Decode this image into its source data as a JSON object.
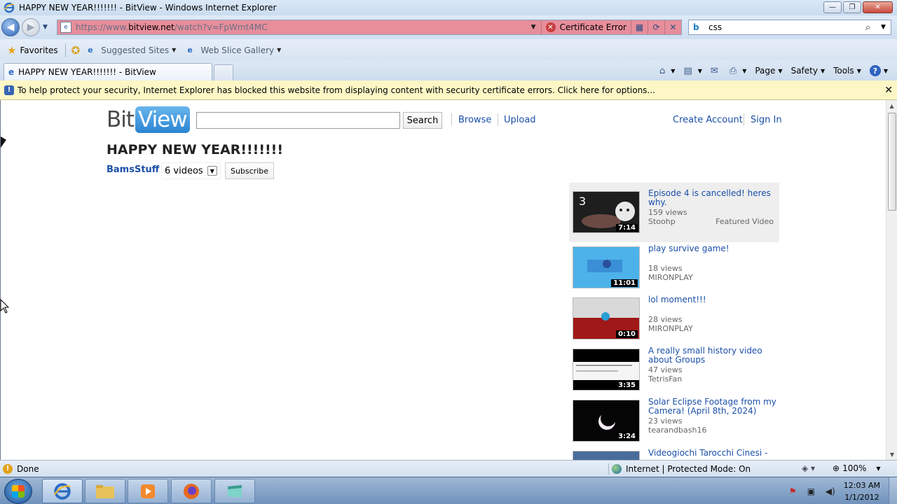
{
  "window": {
    "title": "HAPPY NEW YEAR!!!!!!! - BitView - Windows Internet Explorer",
    "controls": {
      "minimize": "—",
      "maximize": "❐",
      "close": "✕"
    }
  },
  "address_bar": {
    "url_prefix": "https://www.",
    "url_domain": "bitview.net",
    "url_path": "/watch?v=FpWmt4MC",
    "certificate_error": "Certificate Error"
  },
  "search_bar": {
    "provider_icon": "b",
    "value": "css"
  },
  "favorites_bar": {
    "favorites_label": "Favorites",
    "links": [
      {
        "label": "Suggested Sites"
      },
      {
        "label": "Web Slice Gallery"
      }
    ]
  },
  "tabs": [
    {
      "label": "HAPPY NEW YEAR!!!!!!! - BitView"
    }
  ],
  "command_bar": {
    "page": "Page",
    "safety": "Safety",
    "tools": "Tools"
  },
  "security_bar": {
    "message": "To help protect your security, Internet Explorer has blocked this website from displaying content with security certificate errors. Click here for options..."
  },
  "site": {
    "logo_bit": "Bit",
    "logo_view": "View",
    "search_button": "Search",
    "nav": {
      "browse": "Browse",
      "upload": "Upload",
      "create_account": "Create Account",
      "sign_in": "Sign In"
    },
    "video_title": "HAPPY NEW YEAR!!!!!!!",
    "channel": "BamsStuff",
    "video_count": "6 videos",
    "subscribe": "Subscribe"
  },
  "related_videos": [
    {
      "title": "Episode 4 is cancelled! heres why.",
      "views": "159 views",
      "author": "Stoohp",
      "duration": "7:14",
      "featured": "Featured Video",
      "thumb_color": "#2a2a2a",
      "thumb_number": "3"
    },
    {
      "title": "play survive game!",
      "views": "18 views",
      "author": "MIRONPLAY",
      "duration": "11:01",
      "thumb_color": "#3fa3e0"
    },
    {
      "title": "lol moment!!!",
      "views": "28 views",
      "author": "MIRONPLAY",
      "duration": "0:10",
      "thumb_color": "#8a1a1a"
    },
    {
      "title": "A really small history video about Groups",
      "views": "47 views",
      "author": "TetrisFan",
      "duration": "3:35",
      "thumb_color": "#f2f2f2"
    },
    {
      "title": "Solar Eclipse Footage from my Camera! (April 8th, 2024)",
      "views": "23 views",
      "author": "tearandbash16",
      "duration": "3:24",
      "thumb_color": "#050505"
    },
    {
      "title": "Videogiochi Tarocchi Cinesi -",
      "views": "",
      "author": "",
      "duration": "",
      "thumb_color": "#4a6c9a"
    }
  ],
  "status_bar": {
    "status": "Done",
    "zone": "Internet | Protected Mode: On",
    "zoom": "100%"
  },
  "taskbar": {
    "time": "12:03 AM",
    "date": "1/1/2012"
  }
}
